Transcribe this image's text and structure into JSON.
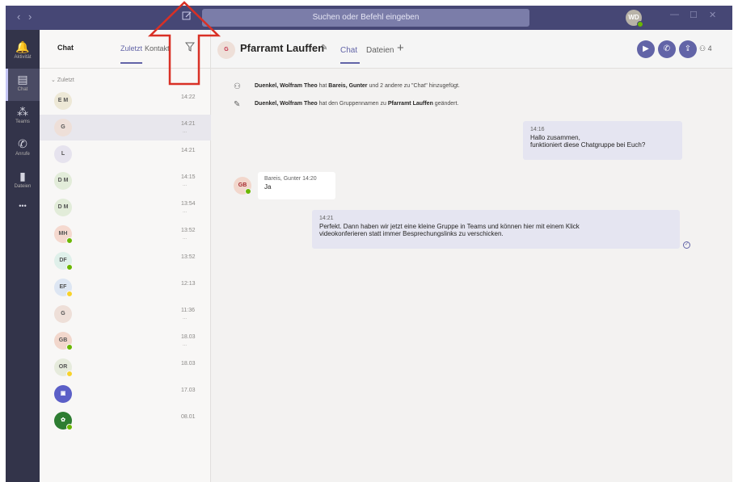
{
  "titlebar": {
    "back_glyph": "‹",
    "forward_glyph": "›",
    "compose_icon": "compose-icon",
    "search_placeholder": "Suchen oder Befehl eingeben",
    "me_initials": "WD",
    "minimize_glyph": "—",
    "maximize_glyph": "☐",
    "close_glyph": "✕"
  },
  "appbar": {
    "items": [
      {
        "label": "Aktivität",
        "icon": "bell-icon",
        "glyph": "🔔"
      },
      {
        "label": "Chat",
        "icon": "chat-icon",
        "glyph": "▤"
      },
      {
        "label": "Teams",
        "icon": "teams-icon",
        "glyph": "⁂"
      },
      {
        "label": "Anrufe",
        "icon": "phone-icon",
        "glyph": "✆"
      },
      {
        "label": "Dateien",
        "icon": "files-icon",
        "glyph": "▮"
      },
      {
        "label": "",
        "icon": "more-icon",
        "glyph": "•••"
      }
    ]
  },
  "chatlist": {
    "title": "Chat",
    "tab_recent": "Zuletzt",
    "tab_contacts": "Kontakt",
    "filter_icon": "filter-icon",
    "section_label": "Zuletzt",
    "rows": [
      {
        "initials": "E M",
        "time": "14:22",
        "dots": "",
        "avatar_bg": "#ede8d6",
        "status": ""
      },
      {
        "initials": "G",
        "time": "14:21",
        "dots": "...",
        "avatar_bg": "#eedfd8",
        "status": ""
      },
      {
        "initials": "L",
        "time": "14:21",
        "dots": "",
        "avatar_bg": "#e6e3ee",
        "status": ""
      },
      {
        "initials": "D M",
        "time": "14:15",
        "dots": "...",
        "avatar_bg": "#e2ecd9",
        "status": ""
      },
      {
        "initials": "D M",
        "time": "13:54",
        "dots": "...",
        "avatar_bg": "#e2ecd9",
        "status": ""
      },
      {
        "initials": "MH",
        "time": "13:52",
        "dots": "...",
        "avatar_bg": "#f5d9cf",
        "status": "#6bb700"
      },
      {
        "initials": "DF",
        "time": "13:52",
        "dots": "",
        "avatar_bg": "#dff0ea",
        "status": "#6bb700"
      },
      {
        "initials": "EF",
        "time": "12:13",
        "dots": "",
        "avatar_bg": "#dde6f3",
        "status": "#f8d22a"
      },
      {
        "initials": "G",
        "time": "11:36",
        "dots": "...",
        "avatar_bg": "#eedfd8",
        "status": ""
      },
      {
        "initials": "GB",
        "time": "18.03",
        "dots": "...",
        "avatar_bg": "#f2d7cc",
        "status": "#6bb700"
      },
      {
        "initials": "OR",
        "time": "18.03",
        "dots": "",
        "avatar_bg": "#e6ebdc",
        "status": "#f8d22a"
      },
      {
        "initials": "▣",
        "time": "17.03",
        "dots": "",
        "avatar_bg": "#5b5fc7",
        "status": ""
      },
      {
        "initials": "✿",
        "time": "08.01",
        "dots": "",
        "avatar_bg": "#2e7d32",
        "status": "#6bb700"
      }
    ]
  },
  "chat": {
    "group_initials": "G",
    "group_name": "Pfarramt Lauffen",
    "tab_chat": "Chat",
    "tab_files": "Dateien",
    "participants_count": "4",
    "system_messages": [
      {
        "icon": "add-people-icon",
        "actor": "Duenkel, Wolfram Theo",
        "mid": " hat ",
        "target": "Bareis, Gunter",
        "rest": " und 2 andere zu \"Chat\" hinzugefügt."
      },
      {
        "icon": "pencil-icon",
        "actor": "Duenkel, Wolfram Theo",
        "mid": " hat den Gruppennamen zu ",
        "target": "Pfarramt Lauffen",
        "rest": " geändert."
      }
    ],
    "msg1": {
      "time": "14:16",
      "line1": "Hallo zusammen,",
      "line2": "funktioniert diese Chatgruppe bei Euch?"
    },
    "msg2": {
      "sender": "Bareis, Gunter",
      "time": "14:20",
      "text": "Ja",
      "initials": "GB"
    },
    "msg3": {
      "time": "14:21",
      "line1": "Perfekt. Dann haben wir jetzt eine kleine Gruppe in Teams und können hier mit einem Klick",
      "line2": "videokonferieren statt immer Besprechungslinks zu verschicken."
    }
  },
  "colors": {
    "titlebar": "#464775",
    "appbar": "#33344a",
    "accent": "#6264a7",
    "annotation_arrow": "#d93025"
  }
}
